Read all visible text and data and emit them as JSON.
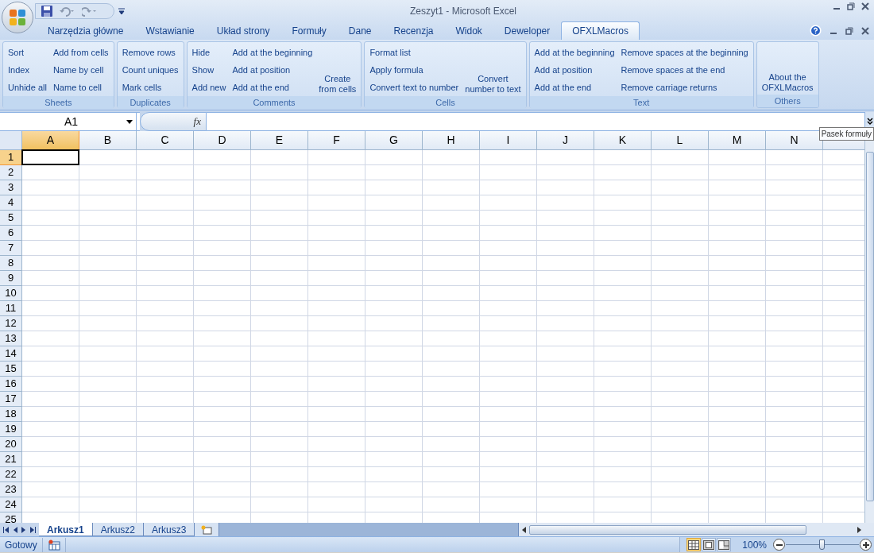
{
  "window": {
    "title": "Zeszyt1 - Microsoft Excel"
  },
  "ribbon_tabs": [
    {
      "label": "Narzędzia główne",
      "selected": false
    },
    {
      "label": "Wstawianie",
      "selected": false
    },
    {
      "label": "Układ strony",
      "selected": false
    },
    {
      "label": "Formuły",
      "selected": false
    },
    {
      "label": "Dane",
      "selected": false
    },
    {
      "label": "Recenzja",
      "selected": false
    },
    {
      "label": "Widok",
      "selected": false
    },
    {
      "label": "Deweloper",
      "selected": false
    },
    {
      "label": "OFXLMacros",
      "selected": true
    }
  ],
  "ribbon_groups": [
    {
      "label": "Sheets",
      "columns": [
        {
          "kind": "small",
          "items": [
            "Sort",
            "Index",
            "Unhide all"
          ]
        },
        {
          "kind": "small",
          "items": [
            "Add from cells",
            "Name by cell",
            "Name to cell"
          ]
        }
      ]
    },
    {
      "label": "Duplicates",
      "columns": [
        {
          "kind": "small",
          "items": [
            "Remove rows",
            "Count uniques",
            "Mark cells"
          ]
        }
      ]
    },
    {
      "label": "Comments",
      "columns": [
        {
          "kind": "small",
          "items": [
            "Hide",
            "Show",
            "Add new"
          ]
        },
        {
          "kind": "small",
          "items": [
            "Add at the beginning",
            "Add at position",
            "Add at the end"
          ]
        },
        {
          "kind": "large",
          "label": "Create\nfrom cells"
        }
      ]
    },
    {
      "label": "Cells",
      "columns": [
        {
          "kind": "small",
          "items": [
            "Format list",
            "Apply formula",
            "Convert text to number"
          ]
        },
        {
          "kind": "large",
          "label": "Convert\nnumber to text"
        }
      ]
    },
    {
      "label": "Text",
      "columns": [
        {
          "kind": "small",
          "items": [
            "Add at the beginning",
            "Add at position",
            "Add at the end"
          ]
        },
        {
          "kind": "small",
          "items": [
            "Remove spaces at the beginning",
            "Remove spaces at the end",
            "Remove carriage returns"
          ]
        }
      ]
    },
    {
      "label": "Others",
      "columns": [
        {
          "kind": "large",
          "label": "About the\nOFXLMacros"
        }
      ]
    }
  ],
  "formula_bar": {
    "name_box": "A1",
    "fx": "fx",
    "tooltip": "Pasek formuły"
  },
  "columns": [
    {
      "label": "A",
      "selected": true
    },
    {
      "label": "B",
      "selected": false
    },
    {
      "label": "C",
      "selected": false
    },
    {
      "label": "D",
      "selected": false
    },
    {
      "label": "E",
      "selected": false
    },
    {
      "label": "F",
      "selected": false
    },
    {
      "label": "G",
      "selected": false
    },
    {
      "label": "H",
      "selected": false
    },
    {
      "label": "I",
      "selected": false
    },
    {
      "label": "J",
      "selected": false
    },
    {
      "label": "K",
      "selected": false
    },
    {
      "label": "L",
      "selected": false
    },
    {
      "label": "M",
      "selected": false
    },
    {
      "label": "N",
      "selected": false
    }
  ],
  "rows": [
    {
      "label": "1",
      "selected": true
    },
    {
      "label": "2",
      "selected": false
    },
    {
      "label": "3",
      "selected": false
    },
    {
      "label": "4",
      "selected": false
    },
    {
      "label": "5",
      "selected": false
    },
    {
      "label": "6",
      "selected": false
    },
    {
      "label": "7",
      "selected": false
    },
    {
      "label": "8",
      "selected": false
    },
    {
      "label": "9",
      "selected": false
    },
    {
      "label": "10",
      "selected": false
    },
    {
      "label": "11",
      "selected": false
    },
    {
      "label": "12",
      "selected": false
    },
    {
      "label": "13",
      "selected": false
    },
    {
      "label": "14",
      "selected": false
    },
    {
      "label": "15",
      "selected": false
    },
    {
      "label": "16",
      "selected": false
    },
    {
      "label": "17",
      "selected": false
    },
    {
      "label": "18",
      "selected": false
    },
    {
      "label": "19",
      "selected": false
    },
    {
      "label": "20",
      "selected": false
    },
    {
      "label": "21",
      "selected": false
    },
    {
      "label": "22",
      "selected": false
    },
    {
      "label": "23",
      "selected": false
    },
    {
      "label": "24",
      "selected": false
    },
    {
      "label": "25",
      "selected": false
    }
  ],
  "sheet_tabs": [
    {
      "label": "Arkusz1",
      "selected": true
    },
    {
      "label": "Arkusz2",
      "selected": false
    },
    {
      "label": "Arkusz3",
      "selected": false
    }
  ],
  "status_bar": {
    "text": "Gotowy",
    "zoom": "100%",
    "zoom_slider": {
      "level": 0.5
    },
    "views": [
      {
        "kind": "normal",
        "selected": true
      },
      {
        "kind": "page_layout",
        "selected": false
      },
      {
        "kind": "page_break",
        "selected": false
      }
    ]
  }
}
